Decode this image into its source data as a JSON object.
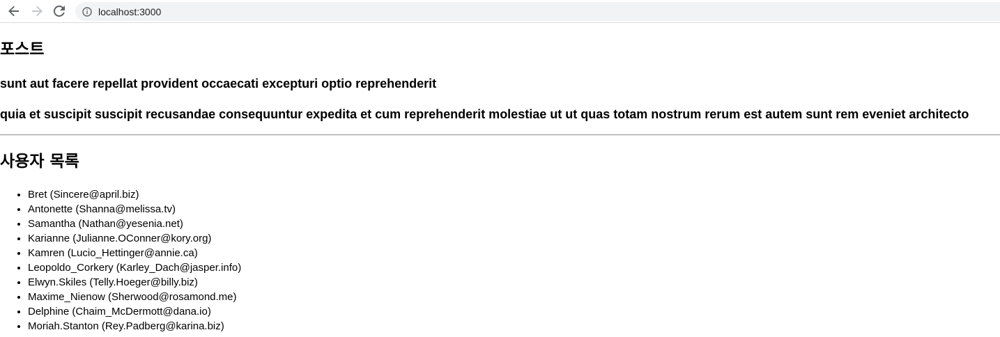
{
  "browser": {
    "url": "localhost:3000",
    "back_icon": "arrow-left-icon",
    "forward_icon": "arrow-right-icon",
    "reload_icon": "reload-icon",
    "info_icon": "info-icon"
  },
  "posts": {
    "heading": "포스트",
    "title": "sunt aut facere repellat provident occaecati excepturi optio reprehenderit",
    "body": "quia et suscipit suscipit recusandae consequuntur expedita et cum reprehenderit molestiae ut ut quas totam nostrum rerum est autem sunt rem eveniet architecto"
  },
  "users": {
    "heading": "사용자 목록",
    "items": [
      "Bret (Sincere@april.biz)",
      "Antonette (Shanna@melissa.tv)",
      "Samantha (Nathan@yesenia.net)",
      "Karianne (Julianne.OConner@kory.org)",
      "Kamren (Lucio_Hettinger@annie.ca)",
      "Leopoldo_Corkery (Karley_Dach@jasper.info)",
      "Elwyn.Skiles (Telly.Hoeger@billy.biz)",
      "Maxime_Nienow (Sherwood@rosamond.me)",
      "Delphine (Chaim_McDermott@dana.io)",
      "Moriah.Stanton (Rey.Padberg@karina.biz)"
    ]
  }
}
